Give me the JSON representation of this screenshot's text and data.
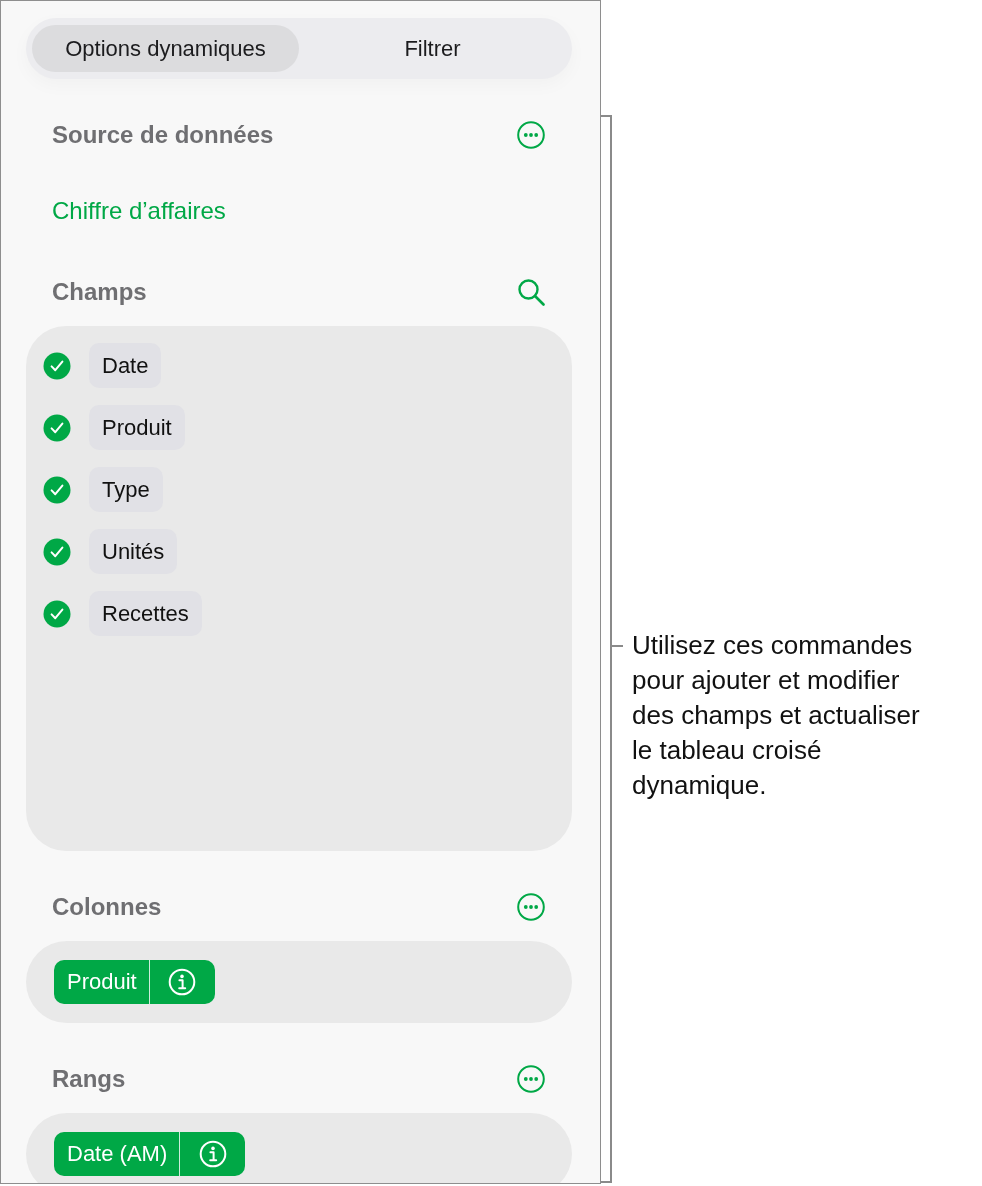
{
  "tabs": [
    {
      "label": "Options dynamiques",
      "selected": true
    },
    {
      "label": "Filtrer",
      "selected": false
    }
  ],
  "sections": [
    {
      "kind": "source",
      "title": "Source de données",
      "action": {
        "kind": "more"
      },
      "source_name": "Chiffre d’affaires"
    },
    {
      "kind": "fields",
      "title": "Champs",
      "action": {
        "kind": "search"
      },
      "fields": [
        {
          "label": "Date",
          "checked": true
        },
        {
          "label": "Produit",
          "checked": true
        },
        {
          "label": "Type",
          "checked": true
        },
        {
          "label": "Unités",
          "checked": true
        },
        {
          "label": "Recettes",
          "checked": true
        }
      ]
    },
    {
      "kind": "zone",
      "title": "Colonnes",
      "action": {
        "kind": "more"
      },
      "items": [
        {
          "label": "Produit"
        }
      ]
    },
    {
      "kind": "zone",
      "title": "Rangs",
      "action": {
        "kind": "more"
      },
      "items": [
        {
          "label": "Date (AM)"
        }
      ]
    }
  ],
  "callout": {
    "text": "Utilisez ces commandes pour ajouter et modifier des champs et actualiser le tableau croisé dynamique."
  }
}
